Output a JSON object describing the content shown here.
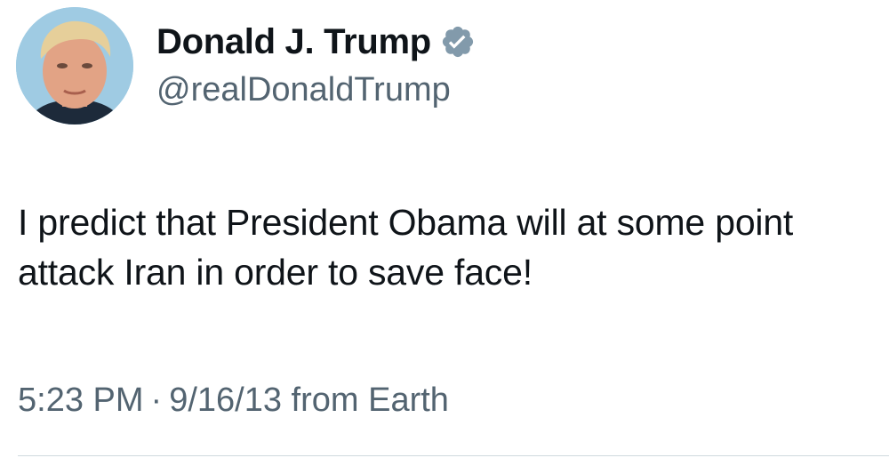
{
  "author": {
    "display_name": "Donald J. Trump",
    "handle": "@realDonaldTrump",
    "verified_icon": "verified-badge-icon",
    "verified_color": "#829aab"
  },
  "tweet": {
    "text": "I predict that President Obama will at some point attack Iran in order to save face!"
  },
  "meta": {
    "time": "5:23 PM",
    "separator": "·",
    "date": "9/16/13",
    "source": "from Earth"
  },
  "colors": {
    "text_primary": "#0f1419",
    "text_secondary": "#536471",
    "divider": "#cfd9de"
  }
}
